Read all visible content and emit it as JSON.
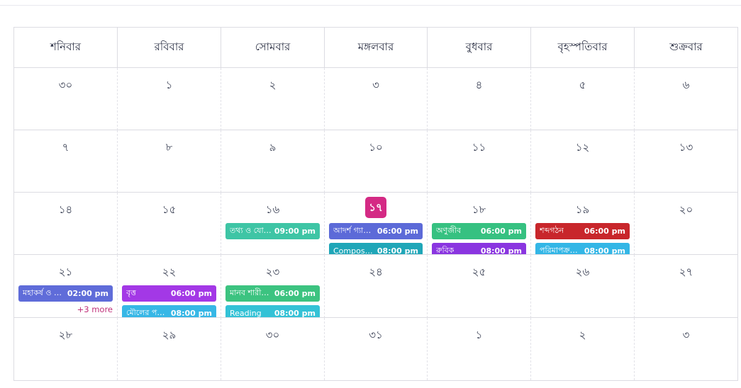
{
  "weekdays": [
    "শনিবার",
    "রবিবার",
    "সোমবার",
    "মঙ্গলবার",
    "বুধবার",
    "বৃহস্পতিবার",
    "শুক্রবার"
  ],
  "weeks": [
    [
      {
        "day": "৩০"
      },
      {
        "day": "১"
      },
      {
        "day": "২"
      },
      {
        "day": "৩"
      },
      {
        "day": "৪"
      },
      {
        "day": "৫"
      },
      {
        "day": "৬"
      }
    ],
    [
      {
        "day": "৭"
      },
      {
        "day": "৮"
      },
      {
        "day": "৯"
      },
      {
        "day": "১০"
      },
      {
        "day": "১১"
      },
      {
        "day": "১২"
      },
      {
        "day": "১৩"
      }
    ],
    [
      {
        "day": "১৪"
      },
      {
        "day": "১৫"
      },
      {
        "day": "১৬",
        "events": [
          {
            "title": "তথ্য ও যোগা...",
            "time": "09:00 pm",
            "color": "#3ec5a5"
          }
        ]
      },
      {
        "day": "১৭",
        "today": true,
        "events": [
          {
            "title": "আদর্শ গ্যাস ...",
            "time": "06:00 pm",
            "color": "#5c6ad8"
          },
          {
            "title": "Compositio...",
            "time": "08:00 pm",
            "color": "#1fa6b8"
          }
        ]
      },
      {
        "day": "১৮",
        "events": [
          {
            "title": "অণুজীব",
            "time": "06:00 pm",
            "color": "#36c181"
          },
          {
            "title": "রুবিক",
            "time": "08:00 pm",
            "color": "#8a35e0"
          }
        ]
      },
      {
        "day": "১৯",
        "events": [
          {
            "title": "শব্দগঠন",
            "time": "06:00 pm",
            "color": "#c8262b"
          },
          {
            "title": "পরিমাপক্রম...",
            "time": "08:00 pm",
            "color": "#33b6e6"
          }
        ]
      },
      {
        "day": "২০"
      }
    ],
    [
      {
        "day": "২১",
        "events": [
          {
            "title": "মহাকর্ষ ও অ...",
            "time": "02:00 pm",
            "color": "#5f6cd9"
          }
        ],
        "more": "+3 more"
      },
      {
        "day": "২২",
        "events": [
          {
            "title": "বৃত্ত",
            "time": "06:00 pm",
            "color": "#a338e6"
          },
          {
            "title": "মৌলের পর্যা...",
            "time": "08:00 pm",
            "color": "#36b7e6"
          }
        ]
      },
      {
        "day": "২৩",
        "events": [
          {
            "title": "মানব শারীর...",
            "time": "06:00 pm",
            "color": "#3cc380"
          },
          {
            "title": "Reading",
            "time": "08:00 pm",
            "color": "#33c2d6"
          }
        ]
      },
      {
        "day": "২৪"
      },
      {
        "day": "২৫"
      },
      {
        "day": "২৬"
      },
      {
        "day": "২৭"
      }
    ],
    [
      {
        "day": "২৮"
      },
      {
        "day": "২৯"
      },
      {
        "day": "৩০"
      },
      {
        "day": "৩১"
      },
      {
        "day": "১"
      },
      {
        "day": "২"
      },
      {
        "day": "৩"
      }
    ]
  ]
}
